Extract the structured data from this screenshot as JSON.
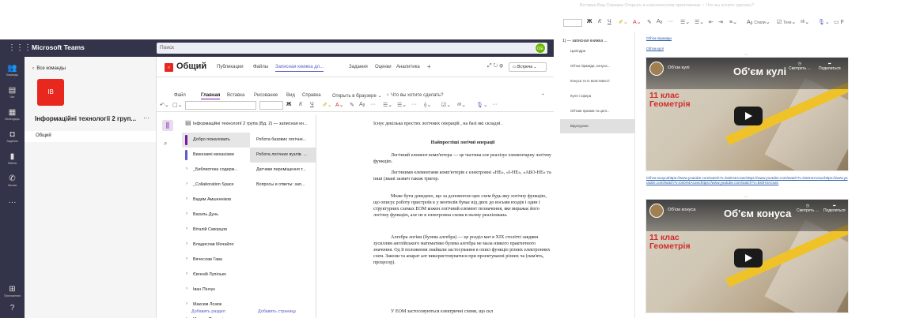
{
  "teams": {
    "app_title": "Microsoft Teams",
    "search_placeholder": "Поиск",
    "user_initials": "ОЕ",
    "rail": [
      {
        "icon": "activity-icon",
        "glyph": "🔔",
        "label": "Команды"
      },
      {
        "icon": "chat-icon",
        "glyph": "▤",
        "label": "Чат"
      },
      {
        "icon": "teams-icon",
        "glyph": "▦",
        "label": "Календарь"
      },
      {
        "icon": "assignments-icon",
        "glyph": "◘",
        "label": "Задания"
      },
      {
        "icon": "files-icon",
        "glyph": "▮",
        "label": "Файлы"
      },
      {
        "icon": "calls-icon",
        "glyph": "✆",
        "label": "Звонки"
      },
      {
        "icon": "more-icon",
        "glyph": "···",
        "label": ""
      },
      {
        "icon": "apps-icon",
        "glyph": "⊞",
        "label": "Приложения"
      },
      {
        "icon": "help-icon",
        "glyph": "?",
        "label": ""
      }
    ],
    "back_label": "Все команды",
    "team_tile": "IB",
    "team_name": "Інформаційні технології 2 груп...",
    "team_more": "···",
    "channel": "Общий"
  },
  "channel_header": {
    "tile": "ІТ",
    "name": "Общий",
    "tabs": [
      "Публикации",
      "Файлы",
      "Записная книжка дл...",
      "Задания",
      "Оценки",
      "Аналитика",
      "+"
    ],
    "active_tab": 2,
    "meet_label": "Встреча"
  },
  "ribbon": {
    "file": "Файл",
    "tabs": [
      "Главная",
      "Вставка",
      "Рисование",
      "Вид",
      "Справка"
    ],
    "active_tab": 0,
    "open_in_browser": "Открыть в браузере",
    "tell_me": "Что вы хотите сделать?"
  },
  "notebook": {
    "title": "Інформаційні технології 2 група (Вд. 2) — записная кн...",
    "sections": [
      {
        "label": "Добро пожаловать",
        "color": "#7719aa",
        "selected": true
      },
      {
        "label": "Виконавчі механізми",
        "color": "#5b5fc7",
        "selected": false
      },
      {
        "label": "_Библиотека содерж...",
        "color": "",
        "selected": false
      },
      {
        "label": "_Collaboration Space",
        "color": "",
        "selected": false
      },
      {
        "label": "Вадим Амшенніков",
        "color": "",
        "selected": false
      },
      {
        "label": "Василь Дунь",
        "color": "",
        "selected": false
      },
      {
        "label": "Віталій Скворцов",
        "color": "",
        "selected": false
      },
      {
        "label": "Владислав Мочайло",
        "color": "",
        "selected": false
      },
      {
        "label": "Вячеслав Гава",
        "color": "",
        "selected": false
      },
      {
        "label": "Євгеній Лупілько",
        "color": "",
        "selected": false
      },
      {
        "label": "Іван Пінчук",
        "color": "",
        "selected": false
      },
      {
        "label": "Максим Лозюк",
        "color": "",
        "selected": false
      },
      {
        "label": "Микита Пильщік",
        "color": "",
        "selected": false
      }
    ],
    "pages": [
      {
        "label": "Робота базових логічне...",
        "selected": false
      },
      {
        "label": "Робота логічних вузлів. ...",
        "selected": true
      },
      {
        "label": "Датчики переміщення т...",
        "selected": false
      },
      {
        "label": "Вопросы и ответы: зап...",
        "selected": false
      }
    ],
    "add_section": "Добавить раздел",
    "add_page": "Добавить страницу"
  },
  "doc": {
    "p1": "Існує декілька простих логічних операцій , на базі які складні .",
    "heading": "Найпростіші логічні операції",
    "p2": "Логічний елемент комп'ютера — це частина еле реалізує елементарну логічну функцію.",
    "p3": "Логічними елементами комп'ютерів є електронні «НЕ», «І-НЕ», «АБО-НЕ» та інші (звані зазвич також тригер.",
    "p4": "Може бути доведено, що за допомогою цих схем будь-яку логічну функцію, що описує роботу пристроїв к у вентилів буває від двох до восьми входів і один і структурних схемах ЕОМ кожен логічний елемент позначення, яке виражає його логічну функцію, але не в електронна схема в ньому реалізована.",
    "p5": "Алгебра логіки (булева алгебра) — це розділ мат в XIX столітті завдяки зусиллям англійського математико булева алгебра не мала ніякого практичного значення. Од її положення знайшли застосування в описі функціо різних електронних схем. Закони та апарат алг використовуватися при проектуванні різних ча (пам'ять, процесор).",
    "p6": "У ЕОМ застосовуються електричні схеми, що скл"
  },
  "onenote": {
    "faded_menu": "Вставка   Вид   Справка   Открыть в классическом приложении   ♀ Что вы хотите сделать?",
    "section_header": "1) — записная книжка ...",
    "pages": [
      {
        "label": "Циліндри",
        "selected": false
      },
      {
        "label": "Об'єм піраміди, конуса...",
        "selected": false
      },
      {
        "label": "Конуси та їх властивості",
        "selected": false
      },
      {
        "label": "Куля і сфера",
        "selected": false
      },
      {
        "label": "Об'єми призми та цилі...",
        "selected": false
      },
      {
        "label": "Відеоуроки",
        "selected": true
      }
    ],
    "link1": "Об'єм піраміди",
    "link2": "Об'єм кулі",
    "video1": {
      "channel": "Об'єм кулі",
      "title": "Об'єм кулі",
      "watch_later": "Смотреть ...",
      "share": "Поделиться",
      "grade": "11 клас",
      "subject": "Геометрія"
    },
    "links_block": "Об'єм конусаhttps://www.youtube.com/watch?v=bs0H4Acxwchttps://www.youtube.com/watch?v=bs0H4Acxwchttps://www.youtube.com/watch?v=bs0H4Acxwchttps://www.youtube.com/watch?v=bs0H4Acxwc",
    "video2": {
      "channel": "Об'єм конуса",
      "title": "Об'єм конуса",
      "watch_later": "Смотреть ...",
      "share": "Поделиться",
      "grade": "11 клас",
      "subject": "Геометрія"
    },
    "toolbar_style": "Стили",
    "toolbar_tags": "Теги",
    "dots": "..."
  },
  "colors": {
    "teams_dark": "#33344a",
    "accent": "#5b5fc7",
    "onenote_purple": "#7719aa",
    "team_red": "#e8281e",
    "link": "#2456a7"
  }
}
